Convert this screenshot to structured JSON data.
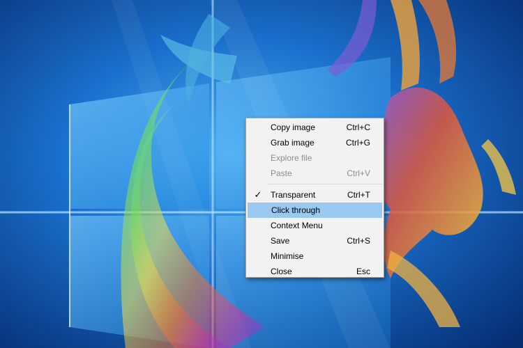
{
  "context_menu": {
    "items": [
      {
        "label": "Copy image",
        "shortcut": "Ctrl+C"
      },
      {
        "label": "Grab image",
        "shortcut": "Ctrl+G"
      },
      {
        "label": "Explore file",
        "shortcut": ""
      },
      {
        "label": "Paste",
        "shortcut": "Ctrl+V"
      },
      {
        "label": "Transparent",
        "shortcut": "Ctrl+T",
        "check": "✓"
      },
      {
        "label": "Click through",
        "shortcut": ""
      },
      {
        "label": "Context Menu",
        "shortcut": ""
      },
      {
        "label": "Save",
        "shortcut": "Ctrl+S"
      },
      {
        "label": "Minimise",
        "shortcut": ""
      },
      {
        "label": "Close",
        "shortcut": "Esc"
      }
    ],
    "disabled_items": [
      "Explore file",
      "Paste"
    ],
    "highlighted_item": "Click through",
    "checked_item": "Transparent"
  },
  "colors": {
    "menu_background": "#f2f2f2",
    "menu_border": "#a0a0a0",
    "highlight": "#99c9ef",
    "disabled_text": "#8d8d8d",
    "desktop_blue": "#0b3f8c"
  },
  "icons": {
    "check": "check-icon"
  }
}
